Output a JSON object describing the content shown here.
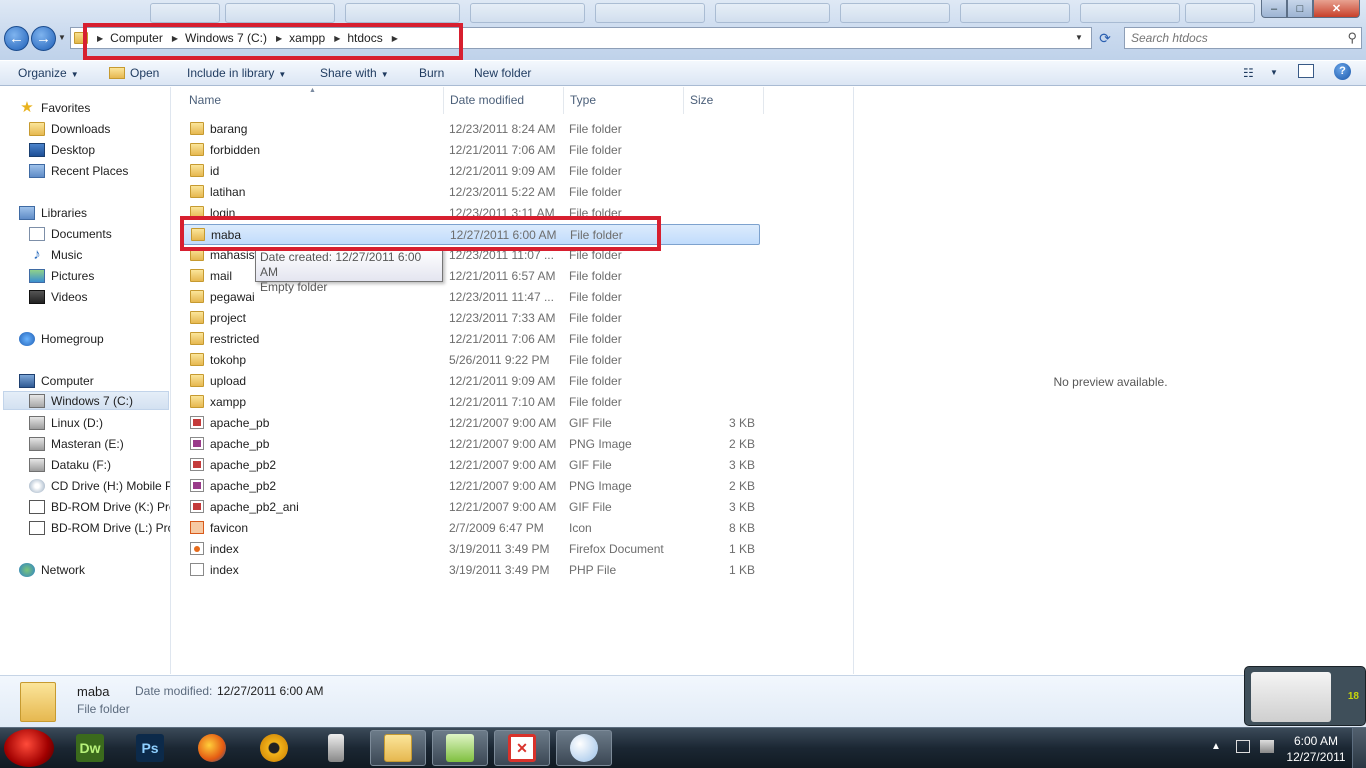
{
  "window": {
    "minimize": "–",
    "maximize": "□",
    "close": "✕"
  },
  "address": {
    "crumbs": [
      "Computer",
      "Windows 7 (C:)",
      "xampp",
      "htdocs"
    ]
  },
  "search": {
    "placeholder": "Search htdocs"
  },
  "toolbar": {
    "organize": "Organize",
    "open": "Open",
    "include_in_library": "Include in library",
    "share_with": "Share with",
    "burn": "Burn",
    "new_folder": "New folder"
  },
  "sidebar": {
    "favorites": "Favorites",
    "downloads": "Downloads",
    "desktop": "Desktop",
    "recent_places": "Recent Places",
    "libraries": "Libraries",
    "documents": "Documents",
    "music": "Music",
    "pictures": "Pictures",
    "videos": "Videos",
    "homegroup": "Homegroup",
    "computer": "Computer",
    "drives": [
      "Windows 7 (C:)",
      "Linux (D:)",
      "Masteran (E:)",
      "Dataku (F:)",
      "CD Drive (H:) Mobile P",
      "BD-ROM Drive (K:) Pro",
      "BD-ROM Drive (L:) Pro"
    ],
    "network": "Network"
  },
  "columns": {
    "name": "Name",
    "date_modified": "Date modified",
    "type": "Type",
    "size": "Size"
  },
  "files": [
    {
      "name": "barang",
      "date": "12/23/2011 8:24 AM",
      "type": "File folder",
      "size": "",
      "icon": "folder-icon"
    },
    {
      "name": "forbidden",
      "date": "12/21/2011 7:06 AM",
      "type": "File folder",
      "size": "",
      "icon": "folder-icon"
    },
    {
      "name": "id",
      "date": "12/21/2011 9:09 AM",
      "type": "File folder",
      "size": "",
      "icon": "folder-icon"
    },
    {
      "name": "latihan",
      "date": "12/23/2011 5:22 AM",
      "type": "File folder",
      "size": "",
      "icon": "folder-icon"
    },
    {
      "name": "login",
      "date": "12/23/2011 3:11 AM",
      "type": "File folder",
      "size": "",
      "icon": "folder-icon"
    },
    {
      "name": "maba",
      "date": "12/27/2011 6:00 AM",
      "type": "File folder",
      "size": "",
      "icon": "folder-icon",
      "selected": true
    },
    {
      "name": "mahasiswa",
      "date": "12/23/2011 11:07 ...",
      "type": "File folder",
      "size": "",
      "icon": "folder-icon"
    },
    {
      "name": "mail",
      "date": "12/21/2011 6:57 AM",
      "type": "File folder",
      "size": "",
      "icon": "folder-icon"
    },
    {
      "name": "pegawai",
      "date": "12/23/2011 11:47 ...",
      "type": "File folder",
      "size": "",
      "icon": "folder-icon"
    },
    {
      "name": "project",
      "date": "12/23/2011 7:33 AM",
      "type": "File folder",
      "size": "",
      "icon": "folder-icon"
    },
    {
      "name": "restricted",
      "date": "12/21/2011 7:06 AM",
      "type": "File folder",
      "size": "",
      "icon": "folder-icon"
    },
    {
      "name": "tokohp",
      "date": "5/26/2011 9:22 PM",
      "type": "File folder",
      "size": "",
      "icon": "folder-icon"
    },
    {
      "name": "upload",
      "date": "12/21/2011 9:09 AM",
      "type": "File folder",
      "size": "",
      "icon": "folder-icon"
    },
    {
      "name": "xampp",
      "date": "12/21/2011 7:10 AM",
      "type": "File folder",
      "size": "",
      "icon": "folder-icon"
    },
    {
      "name": "apache_pb",
      "date": "12/21/2007 9:00 AM",
      "type": "GIF File",
      "size": "3 KB",
      "icon": "gif-image-icon"
    },
    {
      "name": "apache_pb",
      "date": "12/21/2007 9:00 AM",
      "type": "PNG Image",
      "size": "2 KB",
      "icon": "png-image-icon"
    },
    {
      "name": "apache_pb2",
      "date": "12/21/2007 9:00 AM",
      "type": "GIF File",
      "size": "3 KB",
      "icon": "gif-image-icon"
    },
    {
      "name": "apache_pb2",
      "date": "12/21/2007 9:00 AM",
      "type": "PNG Image",
      "size": "2 KB",
      "icon": "png-image-icon"
    },
    {
      "name": "apache_pb2_ani",
      "date": "12/21/2007 9:00 AM",
      "type": "GIF File",
      "size": "3 KB",
      "icon": "gif-image-icon"
    },
    {
      "name": "favicon",
      "date": "2/7/2009 6:47 PM",
      "type": "Icon",
      "size": "8 KB",
      "icon": "xampp-icon-file-icon"
    },
    {
      "name": "index",
      "date": "3/19/2011 3:49 PM",
      "type": "Firefox Document",
      "size": "1 KB",
      "icon": "firefox-document-icon"
    },
    {
      "name": "index",
      "date": "3/19/2011 3:49 PM",
      "type": "PHP File",
      "size": "1 KB",
      "icon": "php-file-icon"
    }
  ],
  "tooltip": {
    "line1": "Date created: 12/27/2011 6:00 AM",
    "line2": "Empty folder"
  },
  "preview": {
    "text": "No preview available."
  },
  "details": {
    "name": "maba",
    "label": "Date modified:",
    "value": "12/27/2011 6:00 AM",
    "type": "File folder"
  },
  "gadget": {
    "value": "18"
  },
  "taskbar": {
    "apps": [
      "Dw",
      "Ps"
    ],
    "time": "6:00 AM",
    "date": "12/27/2011"
  }
}
